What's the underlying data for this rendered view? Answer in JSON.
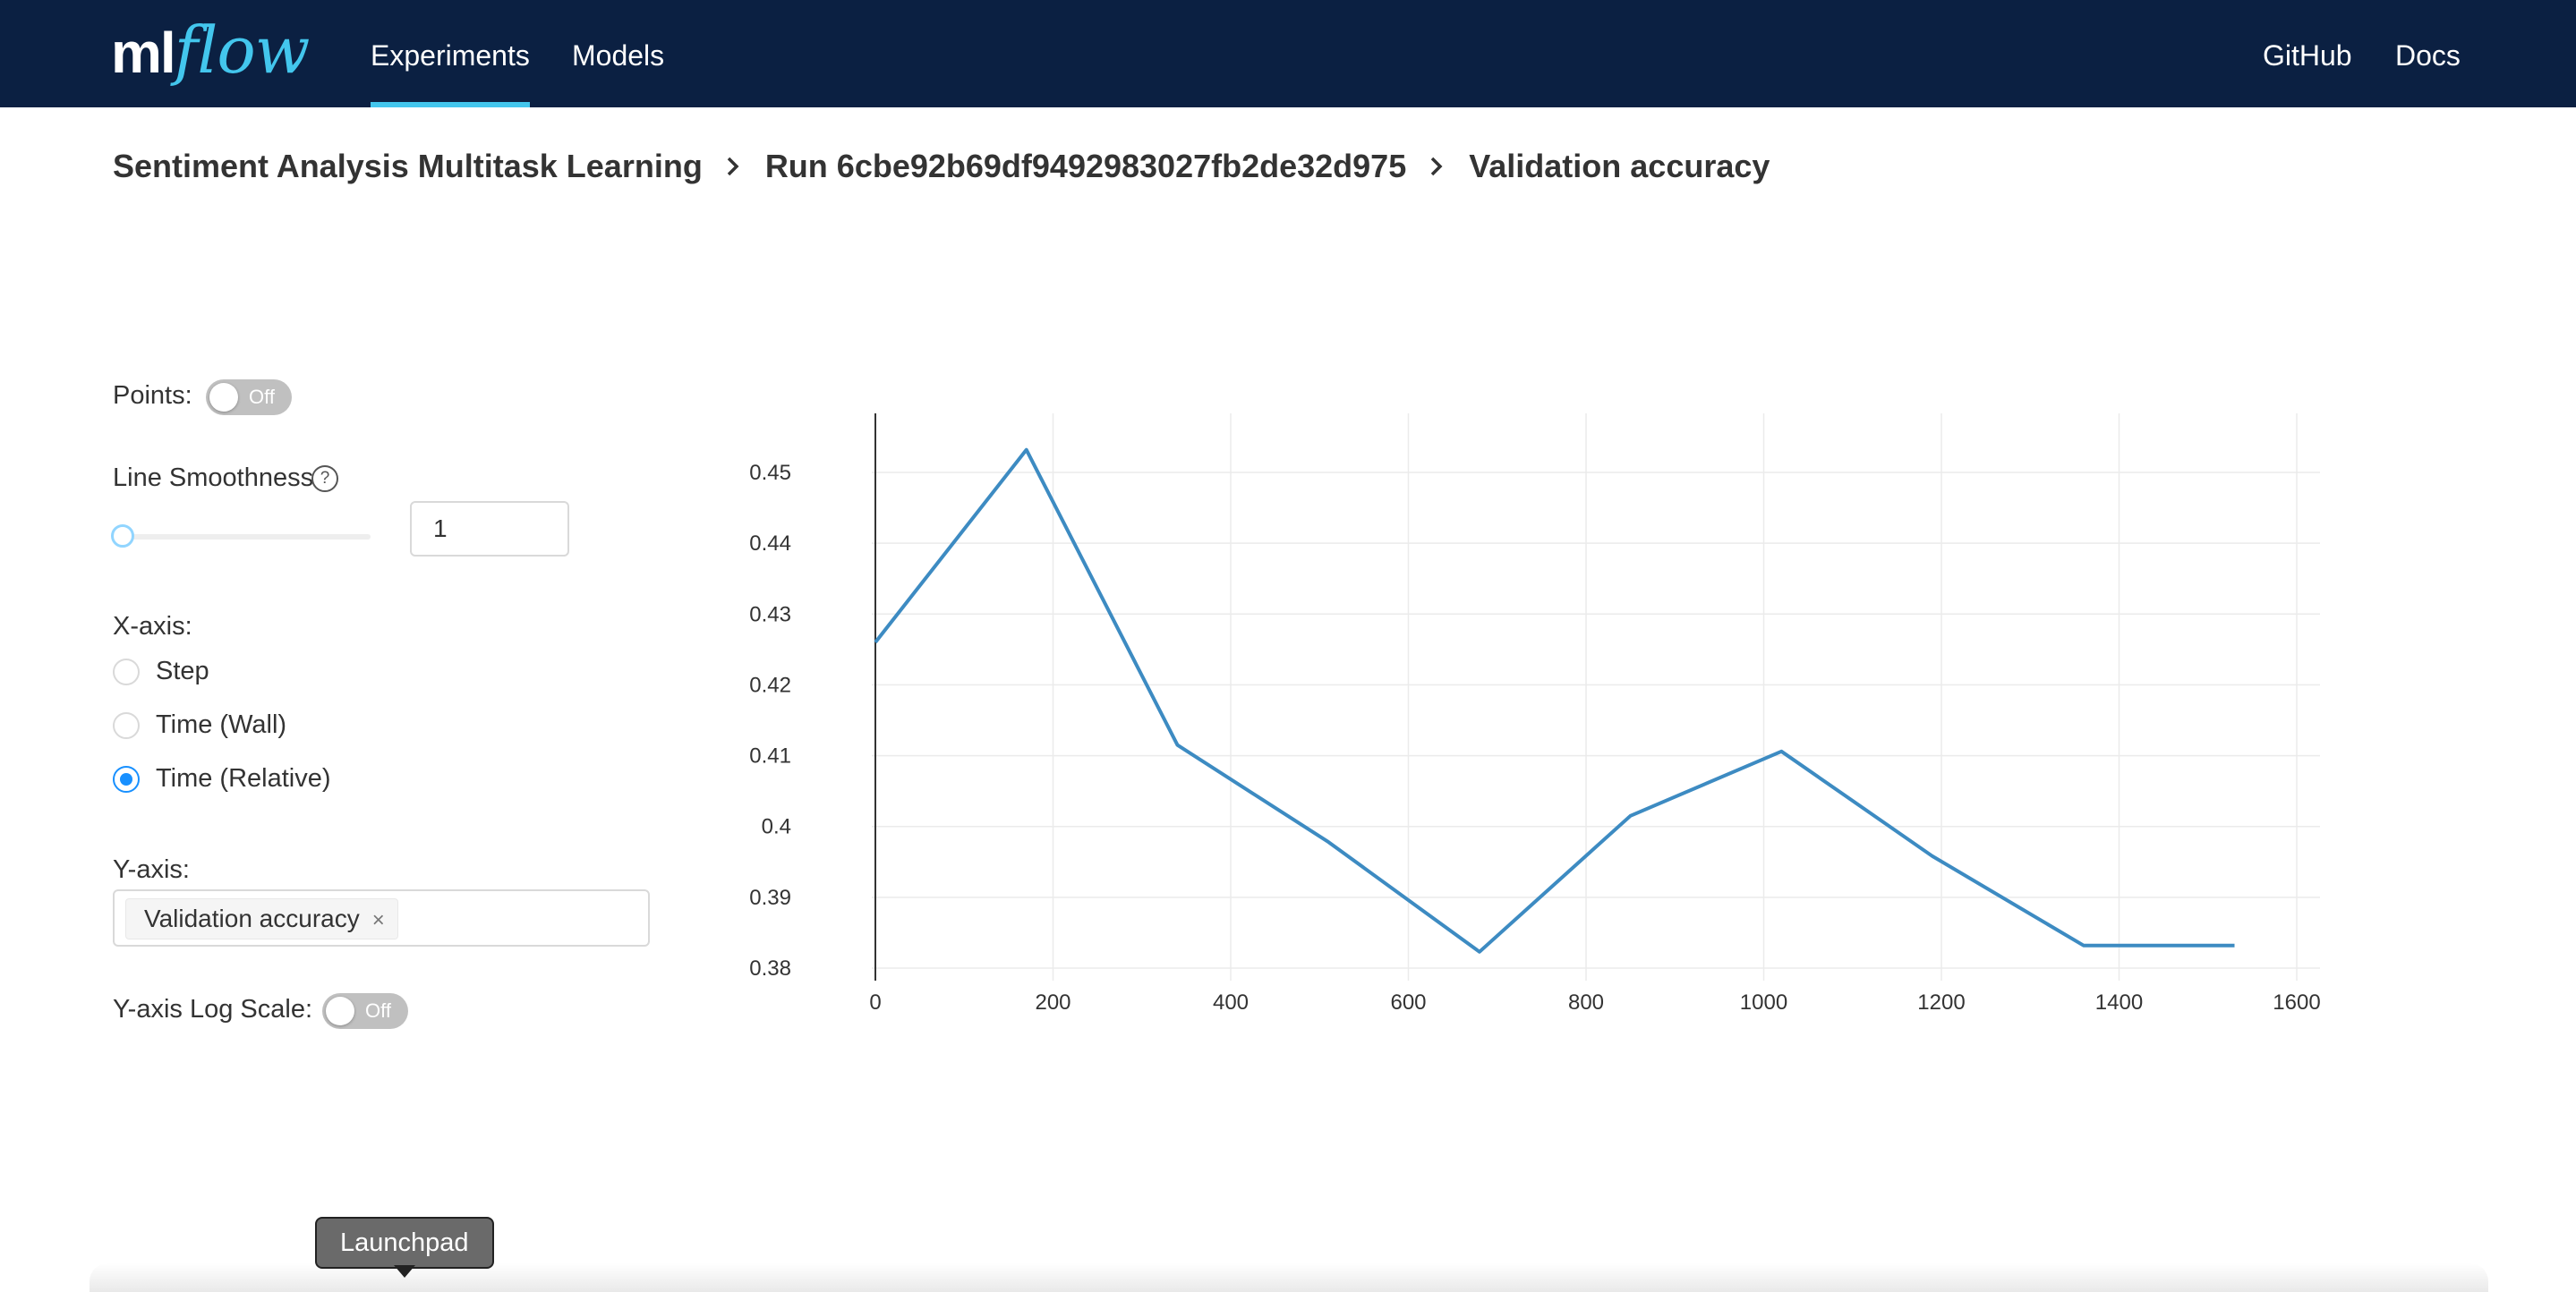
{
  "header": {
    "logo": {
      "ml": "ml",
      "flow": "flow"
    },
    "nav": [
      {
        "label": "Experiments",
        "active": true
      },
      {
        "label": "Models",
        "active": false
      }
    ],
    "right_links": [
      "GitHub",
      "Docs"
    ]
  },
  "breadcrumb": {
    "experiment": "Sentiment Analysis Multitask Learning",
    "run": "Run 6cbe92b69df9492983027fb2de32d975",
    "metric": "Validation accuracy",
    "separator_icon": "chevron-right-icon"
  },
  "controls": {
    "points": {
      "label": "Points:",
      "state": "Off"
    },
    "line_smoothness": {
      "label": "Line Smoothness",
      "help_icon": "question-circle-icon",
      "value": "1",
      "slider_fraction": 0
    },
    "x_axis": {
      "label": "X-axis:",
      "options": [
        {
          "label": "Step",
          "checked": false
        },
        {
          "label": "Time (Wall)",
          "checked": false
        },
        {
          "label": "Time (Relative)",
          "checked": true
        }
      ]
    },
    "y_axis": {
      "label": "Y-axis:",
      "selected": [
        "Validation accuracy"
      ],
      "remove_icon": "close-icon"
    },
    "y_log_scale": {
      "label": "Y-axis Log Scale:",
      "state": "Off"
    }
  },
  "tooltip": {
    "text": "Launchpad"
  },
  "colors": {
    "header_bg": "#0b2042",
    "accent": "#43c6ed",
    "line": "#3d8bc2",
    "radio": "#1890ff"
  },
  "chart_data": {
    "type": "line",
    "title": "",
    "xlabel": "",
    "ylabel": "",
    "x_ticks": [
      0,
      200,
      400,
      600,
      800,
      1000,
      1200,
      1400,
      1600
    ],
    "y_ticks": [
      "0.38",
      "0.39",
      "0.4",
      "0.41",
      "0.42",
      "0.43",
      "0.44",
      "0.45"
    ],
    "xlim": [
      0,
      1600
    ],
    "ylim": [
      0.38,
      0.45
    ],
    "grid": true,
    "series": [
      {
        "x": [
          0,
          170,
          340,
          510,
          680,
          850,
          1020,
          1190,
          1360,
          1530
        ],
        "y": [
          0.426,
          0.4532,
          0.4115,
          0.3978,
          0.3823,
          0.4015,
          0.4106,
          0.3958,
          0.3832,
          0.3832
        ]
      }
    ]
  }
}
